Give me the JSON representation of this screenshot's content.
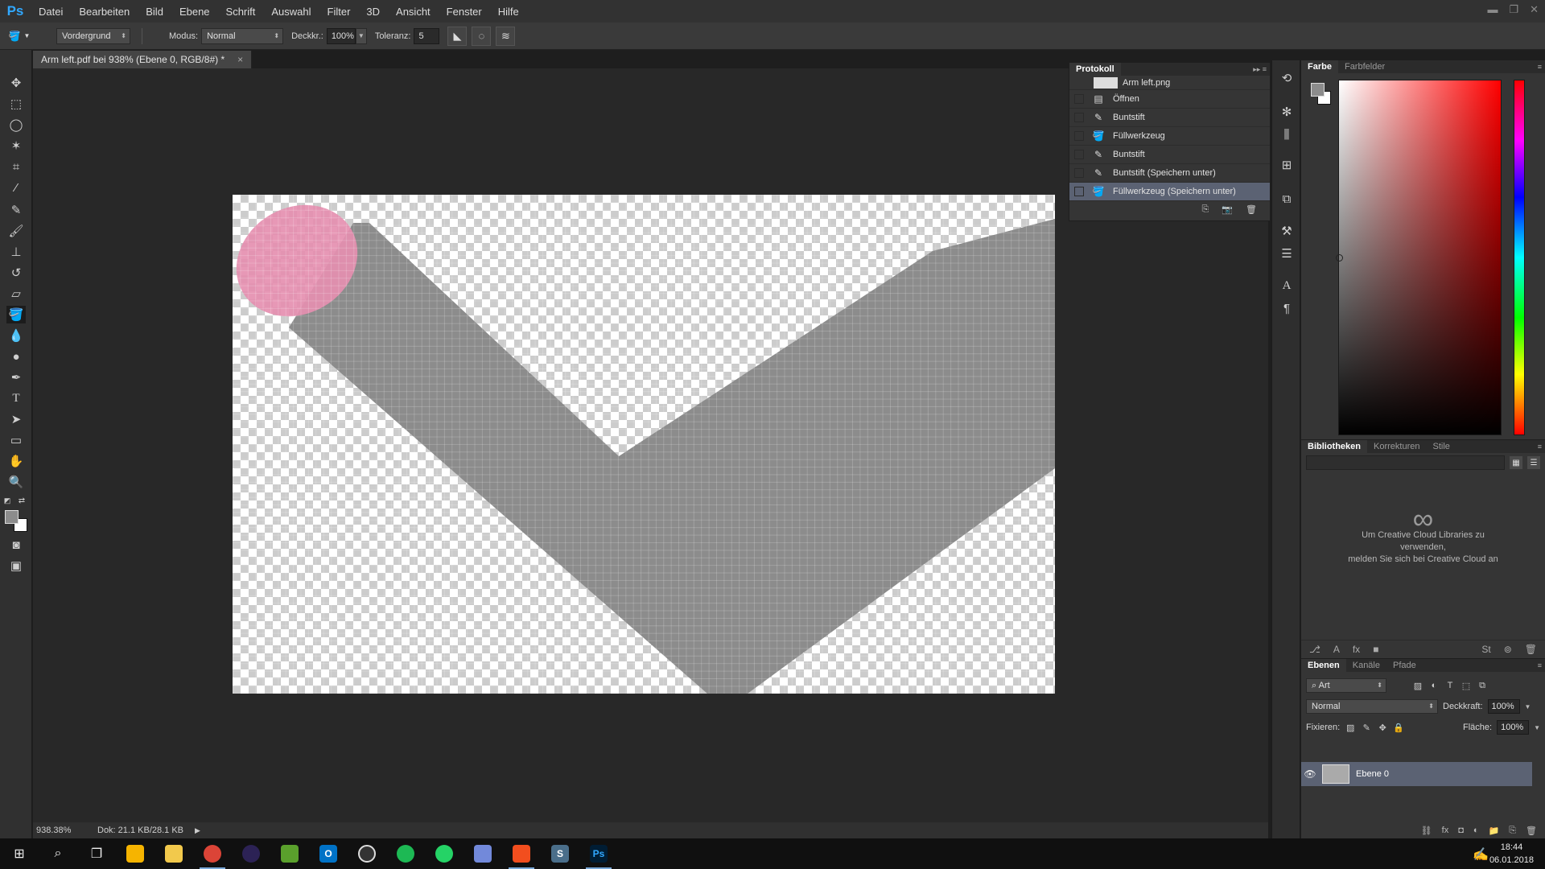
{
  "menubar": {
    "logo": "Ps",
    "items": [
      "Datei",
      "Bearbeiten",
      "Bild",
      "Ebene",
      "Schrift",
      "Auswahl",
      "Filter",
      "3D",
      "Ansicht",
      "Fenster",
      "Hilfe"
    ]
  },
  "options": {
    "fill_source": "Vordergrund",
    "mode_label": "Modus:",
    "mode_value": "Normal",
    "opacity_label": "Deckkr.:",
    "opacity_value": "100%",
    "tolerance_label": "Toleranz:",
    "tolerance_value": "5"
  },
  "document": {
    "tab_title": "Arm left.pdf bei 938% (Ebene 0, RGB/8#) *",
    "close_symbol": "×"
  },
  "status": {
    "zoom": "938.38%",
    "doc_info": "Dok: 21.1 KB/28.1 KB"
  },
  "history": {
    "tab": "Protokoll",
    "snapshot": "Arm left.png",
    "items": [
      {
        "label": "Öffnen",
        "icon": "open-doc-icon"
      },
      {
        "label": "Buntstift",
        "icon": "pencil-icon"
      },
      {
        "label": "Füllwerkzeug",
        "icon": "paint-bucket-icon"
      },
      {
        "label": "Buntstift",
        "icon": "pencil-icon"
      },
      {
        "label": "Buntstift (Speichern unter)",
        "icon": "pencil-icon"
      },
      {
        "label": "Füllwerkzeug (Speichern unter)",
        "icon": "paint-bucket-icon"
      }
    ],
    "selected_index": 5
  },
  "color_panel": {
    "tabs": [
      "Farbe",
      "Farbfelder"
    ],
    "foreground": "#8c8c8c",
    "background": "#ffffff"
  },
  "libraries": {
    "tabs": [
      "Bibliotheken",
      "Korrekturen",
      "Stile"
    ],
    "message_line1": "Um Creative Cloud Libraries zu",
    "message_line2": "verwenden,",
    "message_line3": "melden Sie sich bei Creative Cloud an"
  },
  "layers": {
    "tabs": [
      "Ebenen",
      "Kanäle",
      "Pfade"
    ],
    "filter_value": "Art",
    "blend_mode": "Normal",
    "opacity_label": "Deckkraft:",
    "opacity_value": "100%",
    "lock_label": "Fixieren:",
    "fill_label": "Fläche:",
    "fill_value": "100%",
    "items": [
      {
        "name": "Ebene 0",
        "visible": true
      }
    ]
  },
  "taskbar": {
    "time": "18:44",
    "date": "06.01.2018",
    "apps": [
      "start-button",
      "search-icon",
      "task-view-icon",
      "keep-icon",
      "file-explorer-icon",
      "chrome-icon",
      "eclipse-icon",
      "notepad-icon",
      "outlook-icon",
      "keepass-icon",
      "spotify-icon",
      "whatsapp-icon",
      "discord-icon",
      "figma-icon",
      "sublime-icon",
      "photoshop-icon"
    ]
  },
  "colors": {
    "stroke_gray": "#8c8c8c",
    "pink": "#e58fb0",
    "selected_row": "#5b6273"
  }
}
